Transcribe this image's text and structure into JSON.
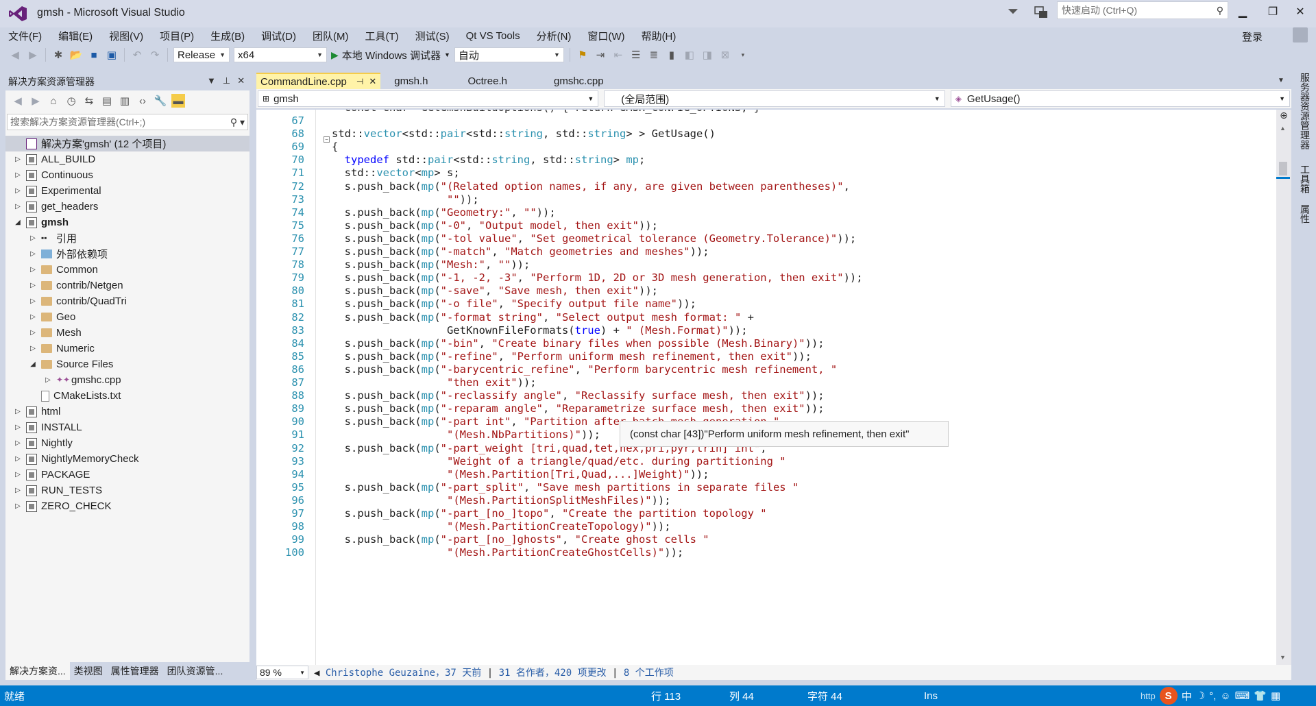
{
  "window": {
    "title": "gmsh - Microsoft Visual Studio",
    "quick_launch_placeholder": "快速启动 (Ctrl+Q)",
    "login": "登录"
  },
  "menu": [
    "文件(F)",
    "编辑(E)",
    "视图(V)",
    "项目(P)",
    "生成(B)",
    "调试(D)",
    "团队(M)",
    "工具(T)",
    "测试(S)",
    "Qt VS Tools",
    "分析(N)",
    "窗口(W)",
    "帮助(H)"
  ],
  "toolbar": {
    "config": "Release",
    "platform": "x64",
    "debugger": "本地 Windows 调试器",
    "auto": "自动"
  },
  "solution_explorer": {
    "title": "解决方案资源管理器",
    "search_placeholder": "搜索解决方案资源管理器(Ctrl+;)",
    "tree": [
      {
        "label": "解决方案'gmsh' (12 个项目)",
        "level": 0,
        "icon": "solution",
        "expander": "",
        "selected": true
      },
      {
        "label": "ALL_BUILD",
        "level": 0,
        "icon": "project",
        "expander": "▷"
      },
      {
        "label": "Continuous",
        "level": 0,
        "icon": "project",
        "expander": "▷"
      },
      {
        "label": "Experimental",
        "level": 0,
        "icon": "project",
        "expander": "▷"
      },
      {
        "label": "get_headers",
        "level": 0,
        "icon": "project",
        "expander": "▷"
      },
      {
        "label": "gmsh",
        "level": 0,
        "icon": "project",
        "expander": "◢",
        "bold": true
      },
      {
        "label": "引用",
        "level": 1,
        "icon": "references",
        "expander": "▷"
      },
      {
        "label": "外部依赖项",
        "level": 1,
        "icon": "external",
        "expander": "▷"
      },
      {
        "label": "Common",
        "level": 1,
        "icon": "folder",
        "expander": "▷"
      },
      {
        "label": "contrib/Netgen",
        "level": 1,
        "icon": "folder",
        "expander": "▷"
      },
      {
        "label": "contrib/QuadTri",
        "level": 1,
        "icon": "folder",
        "expander": "▷"
      },
      {
        "label": "Geo",
        "level": 1,
        "icon": "folder",
        "expander": "▷"
      },
      {
        "label": "Mesh",
        "level": 1,
        "icon": "folder",
        "expander": "▷"
      },
      {
        "label": "Numeric",
        "level": 1,
        "icon": "folder",
        "expander": "▷"
      },
      {
        "label": "Source Files",
        "level": 1,
        "icon": "folder",
        "expander": "◢"
      },
      {
        "label": "gmshc.cpp",
        "level": 2,
        "icon": "cpp",
        "expander": "▷"
      },
      {
        "label": "CMakeLists.txt",
        "level": 1,
        "icon": "file",
        "expander": ""
      },
      {
        "label": "html",
        "level": 0,
        "icon": "project",
        "expander": "▷"
      },
      {
        "label": "INSTALL",
        "level": 0,
        "icon": "project",
        "expander": "▷"
      },
      {
        "label": "Nightly",
        "level": 0,
        "icon": "project",
        "expander": "▷"
      },
      {
        "label": "NightlyMemoryCheck",
        "level": 0,
        "icon": "project",
        "expander": "▷"
      },
      {
        "label": "PACKAGE",
        "level": 0,
        "icon": "project",
        "expander": "▷"
      },
      {
        "label": "RUN_TESTS",
        "level": 0,
        "icon": "project",
        "expander": "▷"
      },
      {
        "label": "ZERO_CHECK",
        "level": 0,
        "icon": "project",
        "expander": "▷"
      }
    ],
    "bottom_tabs": [
      "解决方案资...",
      "类视图",
      "属性管理器",
      "团队资源管..."
    ]
  },
  "editor": {
    "tabs": [
      "CommandLine.cpp",
      "gmsh.h",
      "Octree.h",
      "gmshc.cpp"
    ],
    "nav": {
      "project": "gmsh",
      "scope": "(全局范围)",
      "member": "GetUsage()"
    },
    "top_partial": "  const char *GetGmshBuildOptions() { return GMSH_CONFIG_OPTIONS; }",
    "lines": [
      {
        "n": "67",
        "t": []
      },
      {
        "n": "68",
        "t": [
          [
            "",
            "std::"
          ],
          [
            "ty",
            "vector"
          ],
          [
            "",
            "<std::"
          ],
          [
            "ty",
            "pair"
          ],
          [
            "",
            "<std::"
          ],
          [
            "ty",
            "string"
          ],
          [
            "",
            ", std::"
          ],
          [
            "ty",
            "string"
          ],
          [
            "",
            "> > GetUsage()"
          ]
        ]
      },
      {
        "n": "69",
        "t": [
          [
            "",
            "{"
          ]
        ]
      },
      {
        "n": "70",
        "t": [
          [
            "",
            "  "
          ],
          [
            "kw",
            "typedef"
          ],
          [
            "",
            " std::"
          ],
          [
            "ty",
            "pair"
          ],
          [
            "",
            "<std::"
          ],
          [
            "ty",
            "string"
          ],
          [
            "",
            ", std::"
          ],
          [
            "ty",
            "string"
          ],
          [
            "",
            "> "
          ],
          [
            "ty",
            "mp"
          ],
          [
            "",
            ";"
          ]
        ]
      },
      {
        "n": "71",
        "t": [
          [
            "",
            "  std::"
          ],
          [
            "ty",
            "vector"
          ],
          [
            "",
            "<"
          ],
          [
            "ty",
            "mp"
          ],
          [
            "",
            "> s;"
          ]
        ]
      },
      {
        "n": "72",
        "t": [
          [
            "",
            "  s.push_back("
          ],
          [
            "ty",
            "mp"
          ],
          [
            "",
            "("
          ],
          [
            "st",
            "\"(Related option names, if any, are given between parentheses)\""
          ],
          [
            "",
            ","
          ]
        ]
      },
      {
        "n": "73",
        "t": [
          [
            "",
            "                  "
          ],
          [
            "st",
            "\"\""
          ],
          [
            "",
            "));"
          ]
        ]
      },
      {
        "n": "74",
        "t": [
          [
            "",
            "  s.push_back("
          ],
          [
            "ty",
            "mp"
          ],
          [
            "",
            "("
          ],
          [
            "st",
            "\"Geometry:\""
          ],
          [
            "",
            ", "
          ],
          [
            "st",
            "\"\""
          ],
          [
            "",
            "));"
          ]
        ]
      },
      {
        "n": "75",
        "t": [
          [
            "",
            "  s.push_back("
          ],
          [
            "ty",
            "mp"
          ],
          [
            "",
            "("
          ],
          [
            "st",
            "\"-0\""
          ],
          [
            "",
            ", "
          ],
          [
            "st",
            "\"Output model, then exit\""
          ],
          [
            "",
            "));"
          ]
        ]
      },
      {
        "n": "76",
        "t": [
          [
            "",
            "  s.push_back("
          ],
          [
            "ty",
            "mp"
          ],
          [
            "",
            "("
          ],
          [
            "st",
            "\"-tol value\""
          ],
          [
            "",
            ", "
          ],
          [
            "st",
            "\"Set geometrical tolerance (Geometry.Tolerance)\""
          ],
          [
            "",
            "));"
          ]
        ]
      },
      {
        "n": "77",
        "t": [
          [
            "",
            "  s.push_back("
          ],
          [
            "ty",
            "mp"
          ],
          [
            "",
            "("
          ],
          [
            "st",
            "\"-match\""
          ],
          [
            "",
            ", "
          ],
          [
            "st",
            "\"Match geometries and meshes\""
          ],
          [
            "",
            "));"
          ]
        ]
      },
      {
        "n": "78",
        "t": [
          [
            "",
            "  s.push_back("
          ],
          [
            "ty",
            "mp"
          ],
          [
            "",
            "("
          ],
          [
            "st",
            "\"Mesh:\""
          ],
          [
            "",
            ", "
          ],
          [
            "st",
            "\"\""
          ],
          [
            "",
            "));"
          ]
        ]
      },
      {
        "n": "79",
        "t": [
          [
            "",
            "  s.push_back("
          ],
          [
            "ty",
            "mp"
          ],
          [
            "",
            "("
          ],
          [
            "st",
            "\"-1, -2, -3\""
          ],
          [
            "",
            ", "
          ],
          [
            "st",
            "\"Perform 1D, 2D or 3D mesh generation, then exit\""
          ],
          [
            "",
            "));"
          ]
        ]
      },
      {
        "n": "80",
        "t": [
          [
            "",
            "  s.push_back("
          ],
          [
            "ty",
            "mp"
          ],
          [
            "",
            "("
          ],
          [
            "st",
            "\"-save\""
          ],
          [
            "",
            ", "
          ],
          [
            "st",
            "\"Save mesh, then exit\""
          ],
          [
            "",
            "));"
          ]
        ]
      },
      {
        "n": "81",
        "t": [
          [
            "",
            "  s.push_back("
          ],
          [
            "ty",
            "mp"
          ],
          [
            "",
            "("
          ],
          [
            "st",
            "\"-o file\""
          ],
          [
            "",
            ", "
          ],
          [
            "st",
            "\"Specify output file name\""
          ],
          [
            "",
            "));"
          ]
        ]
      },
      {
        "n": "82",
        "t": [
          [
            "",
            "  s.push_back("
          ],
          [
            "ty",
            "mp"
          ],
          [
            "",
            "("
          ],
          [
            "st",
            "\"-format string\""
          ],
          [
            "",
            ", "
          ],
          [
            "st",
            "\"Select output mesh format: \""
          ],
          [
            "",
            " +"
          ]
        ]
      },
      {
        "n": "83",
        "t": [
          [
            "",
            "                  GetKnownFileFormats("
          ],
          [
            "kw",
            "true"
          ],
          [
            "",
            ") + "
          ],
          [
            "st",
            "\" (Mesh.Format)\""
          ],
          [
            "",
            "));"
          ]
        ]
      },
      {
        "n": "84",
        "t": [
          [
            "",
            "  s.push_back("
          ],
          [
            "ty",
            "mp"
          ],
          [
            "",
            "("
          ],
          [
            "st",
            "\"-bin\""
          ],
          [
            "",
            ", "
          ],
          [
            "st",
            "\"Create binary files when possible (Mesh.Binary)\""
          ],
          [
            "",
            "));"
          ]
        ]
      },
      {
        "n": "85",
        "t": [
          [
            "",
            "  s.push_back("
          ],
          [
            "ty",
            "mp"
          ],
          [
            "",
            "("
          ],
          [
            "st",
            "\"-refine\""
          ],
          [
            "",
            ", "
          ],
          [
            "st",
            "\"Perform uniform mesh refinement, then exit\""
          ],
          [
            "",
            "));"
          ]
        ]
      },
      {
        "n": "86",
        "t": [
          [
            "",
            "  s.push_back("
          ],
          [
            "ty",
            "mp"
          ],
          [
            "",
            "("
          ],
          [
            "st",
            "\"-barycentric_refine\""
          ],
          [
            "",
            ", "
          ],
          [
            "st",
            "\"Perform barycentric mesh refinement, \""
          ]
        ]
      },
      {
        "n": "87",
        "t": [
          [
            "",
            "                  "
          ],
          [
            "st",
            "\"then exit\""
          ],
          [
            "",
            "));"
          ]
        ]
      },
      {
        "n": "88",
        "t": [
          [
            "",
            "  s.push_back("
          ],
          [
            "ty",
            "mp"
          ],
          [
            "",
            "("
          ],
          [
            "st",
            "\"-reclassify angle\""
          ],
          [
            "",
            ", "
          ],
          [
            "st",
            "\"Reclassify surface mesh, then exit\""
          ],
          [
            "",
            "));"
          ]
        ]
      },
      {
        "n": "89",
        "t": [
          [
            "",
            "  s.push_back("
          ],
          [
            "ty",
            "mp"
          ],
          [
            "",
            "("
          ],
          [
            "st",
            "\"-reparam angle\""
          ],
          [
            "",
            ", "
          ],
          [
            "st",
            "\"Reparametrize surface mesh, then exit\""
          ],
          [
            "",
            "));"
          ]
        ]
      },
      {
        "n": "90",
        "t": [
          [
            "",
            "  s.push_back("
          ],
          [
            "ty",
            "mp"
          ],
          [
            "",
            "("
          ],
          [
            "st",
            "\"-part int\""
          ],
          [
            "",
            ", "
          ],
          [
            "st",
            "\"Partition after batch mesh generation \""
          ]
        ]
      },
      {
        "n": "91",
        "t": [
          [
            "",
            "                  "
          ],
          [
            "st",
            "\"(Mesh.NbPartitions)\""
          ],
          [
            "",
            "));"
          ]
        ]
      },
      {
        "n": "92",
        "t": [
          [
            "",
            "  s.push_back("
          ],
          [
            "ty",
            "mp"
          ],
          [
            "",
            "("
          ],
          [
            "st",
            "\"-part_weight [tri,quad,tet,hex,pri,pyr,trih] int\""
          ],
          [
            "",
            ","
          ]
        ]
      },
      {
        "n": "93",
        "t": [
          [
            "",
            "                  "
          ],
          [
            "st",
            "\"Weight of a triangle/quad/etc. during partitioning \""
          ]
        ]
      },
      {
        "n": "94",
        "t": [
          [
            "",
            "                  "
          ],
          [
            "st",
            "\"(Mesh.Partition[Tri,Quad,...]Weight)\""
          ],
          [
            "",
            "));"
          ]
        ]
      },
      {
        "n": "95",
        "t": [
          [
            "",
            "  s.push_back("
          ],
          [
            "ty",
            "mp"
          ],
          [
            "",
            "("
          ],
          [
            "st",
            "\"-part_split\""
          ],
          [
            "",
            ", "
          ],
          [
            "st",
            "\"Save mesh partitions in separate files \""
          ]
        ]
      },
      {
        "n": "96",
        "t": [
          [
            "",
            "                  "
          ],
          [
            "st",
            "\"(Mesh.PartitionSplitMeshFiles)\""
          ],
          [
            "",
            "));"
          ]
        ]
      },
      {
        "n": "97",
        "t": [
          [
            "",
            "  s.push_back("
          ],
          [
            "ty",
            "mp"
          ],
          [
            "",
            "("
          ],
          [
            "st",
            "\"-part_[no_]topo\""
          ],
          [
            "",
            ", "
          ],
          [
            "st",
            "\"Create the partition topology \""
          ]
        ]
      },
      {
        "n": "98",
        "t": [
          [
            "",
            "                  "
          ],
          [
            "st",
            "\"(Mesh.PartitionCreateTopology)\""
          ],
          [
            "",
            "));"
          ]
        ]
      },
      {
        "n": "99",
        "t": [
          [
            "",
            "  s.push_back("
          ],
          [
            "ty",
            "mp"
          ],
          [
            "",
            "("
          ],
          [
            "st",
            "\"-part_[no_]ghosts\""
          ],
          [
            "",
            ", "
          ],
          [
            "st",
            "\"Create ghost cells \""
          ]
        ]
      },
      {
        "n": "100",
        "t": [
          [
            "",
            "                  "
          ],
          [
            "st",
            "\"(Mesh.PartitionCreateGhostCells)\""
          ],
          [
            "",
            "));"
          ]
        ]
      }
    ],
    "tooltip": "(const char [43])\"Perform uniform mesh refinement, then exit\"",
    "zoom": "89 %",
    "codelens": {
      "author": "Christophe Geuzaine，37 天前",
      "authors": "31 名作者，420 项更改",
      "work": "8 个工作项"
    }
  },
  "right_panel": [
    "服务器资源管理器",
    "工具箱",
    "属性"
  ],
  "status": {
    "ready": "就绪",
    "row": "行 113",
    "col": "列 44",
    "char": "字符 44",
    "ins": "Ins"
  },
  "ime": {
    "url_prefix": "http",
    "symbols": [
      "中",
      "☽",
      "°,",
      "☺",
      "⌨",
      "👕",
      "▦"
    ]
  },
  "colors": {
    "status_bar": "#007acc",
    "active_tab": "#fff3a8",
    "keyword": "#0000ff",
    "type": "#2b91af",
    "string": "#a31515"
  }
}
